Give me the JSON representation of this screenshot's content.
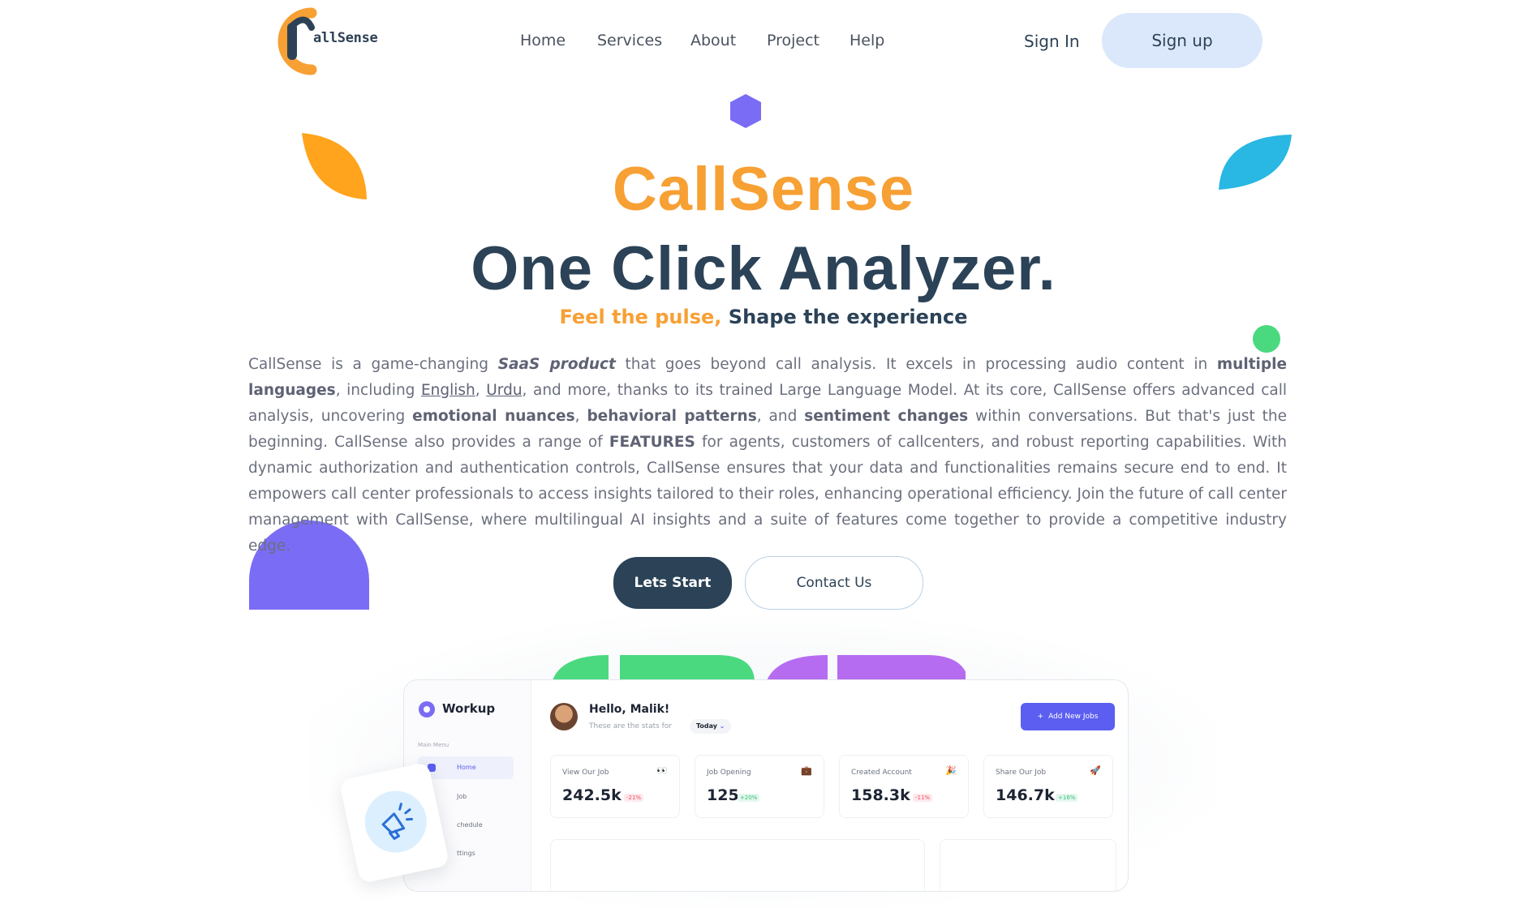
{
  "brand": {
    "logo_letter": "C",
    "logo_text": "allSense"
  },
  "nav": {
    "links": [
      "Home",
      "Services",
      "About",
      "Project",
      "Help"
    ],
    "sign_in": "Sign In",
    "sign_up": "Sign up"
  },
  "hero": {
    "brand_title": "CallSense",
    "title": "One Click Analyzer.",
    "tagline_accent": "Feel the pulse,",
    "tagline_rest": "Shape the experience",
    "body": {
      "p1": "CallSense is a game-changing ",
      "p1_bold": "SaaS product",
      "p2": " that goes beyond call analysis. It excels in processing audio content in ",
      "p2_bold": "multiple languages",
      "p3": ", including ",
      "lang_1": "English",
      "sep": ", ",
      "lang_2": "Urdu",
      "p4": ", and more, thanks to its trained Large Language Model. At its core, CallSense offers advanced call analysis, uncovering ",
      "b1": "emotional nuances",
      "p5": ", ",
      "b2": "behavioral patterns",
      "p6": ", and ",
      "b3": "sentiment changes",
      "p7": " within conversations. But that's just the beginning. CallSense also provides a range of ",
      "b4": "FEATURES",
      "p8": " for agents, customers of callcenters, and robust reporting capabilities. With dynamic authorization and authentication controls, CallSense ensures that your data and functionalities remains secure end to end. It empowers call center professionals to access insights tailored to their roles, enhancing operational efficiency. Join the future of call center management with CallSense, where multilingual AI insights and a suite of features come together to provide a competitive industry edge."
    },
    "btn_start": "Lets Start",
    "btn_contact": "Contact Us"
  },
  "dashboard": {
    "workspace": "Workup",
    "menu_caption": "Main Menu",
    "menu_items": [
      "Home",
      "Job",
      "chedule",
      "ttings"
    ],
    "greeting": "Hello, Malik!",
    "stats_for": "These are the stats for",
    "period": "Today",
    "add_button": "Add New Jobs",
    "stats": [
      {
        "title": "View Our Job",
        "value": "242.5k",
        "delta": "-21%",
        "trend": "neg",
        "icon": "👀"
      },
      {
        "title": "Job Opening",
        "value": "125",
        "delta": "+20%",
        "trend": "pos",
        "icon": "💼"
      },
      {
        "title": "Created Account",
        "value": "158.3k",
        "delta": "-11%",
        "trend": "neg",
        "icon": "🎉"
      },
      {
        "title": "Share Our Job",
        "value": "146.7k",
        "delta": "+16%",
        "trend": "pos",
        "icon": "🚀"
      }
    ]
  },
  "colors": {
    "accent_orange": "#f7a034",
    "navy": "#2b4257",
    "purple": "#7b6cf6",
    "cyan": "#29b7e3",
    "green": "#4ad97f",
    "signup_bg": "#dbe8fb",
    "dashboard_blue": "#5b5ef0"
  },
  "icons": {
    "logo": "callsense-logo-icon",
    "megaphone": "megaphone-icon",
    "add": "plus-icon",
    "workspace": "workup-logo-icon",
    "home": "home-icon"
  }
}
